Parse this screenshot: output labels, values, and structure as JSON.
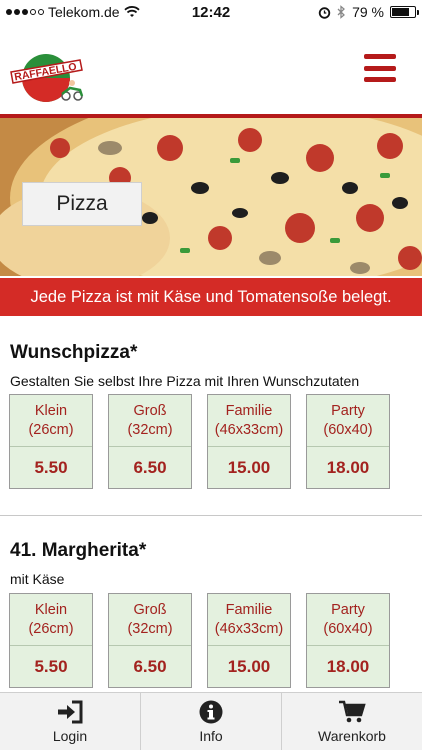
{
  "statusbar": {
    "carrier": "Telekom.de",
    "time": "12:42",
    "battery_percent": "79 %",
    "battery_level": 0.79
  },
  "header": {
    "logo_text": "RAFFAELLO",
    "menu_icon": "hamburger-menu-icon"
  },
  "hero": {
    "category_label": "Pizza"
  },
  "notice": {
    "text": "Jede Pizza ist mit Käse und Tomatensoße belegt."
  },
  "products": [
    {
      "title": "Wunschpizza*",
      "description": "Gestalten Sie selbst Ihre Pizza mit Ihren Wunschzutaten",
      "sizes": [
        {
          "name": "Klein",
          "dim": "(26cm)",
          "price": "5.50"
        },
        {
          "name": "Groß",
          "dim": "(32cm)",
          "price": "6.50"
        },
        {
          "name": "Familie",
          "dim": "(46x33cm)",
          "price": "15.00"
        },
        {
          "name": "Party",
          "dim": "(60x40)",
          "price": "18.00"
        }
      ]
    },
    {
      "title": "41. Margherita*",
      "description": "mit Käse",
      "sizes": [
        {
          "name": "Klein",
          "dim": "(26cm)",
          "price": "5.50"
        },
        {
          "name": "Groß",
          "dim": "(32cm)",
          "price": "6.50"
        },
        {
          "name": "Familie",
          "dim": "(46x33cm)",
          "price": "15.00"
        },
        {
          "name": "Party",
          "dim": "(60x40)",
          "price": "18.00"
        }
      ]
    }
  ],
  "tabbar": {
    "login_label": "Login",
    "info_label": "Info",
    "cart_label": "Warenkorb"
  },
  "colors": {
    "brand_red": "#b51a1a",
    "notice_red": "#d42b26",
    "price_red": "#a3231f",
    "card_green": "#e4f1df"
  }
}
